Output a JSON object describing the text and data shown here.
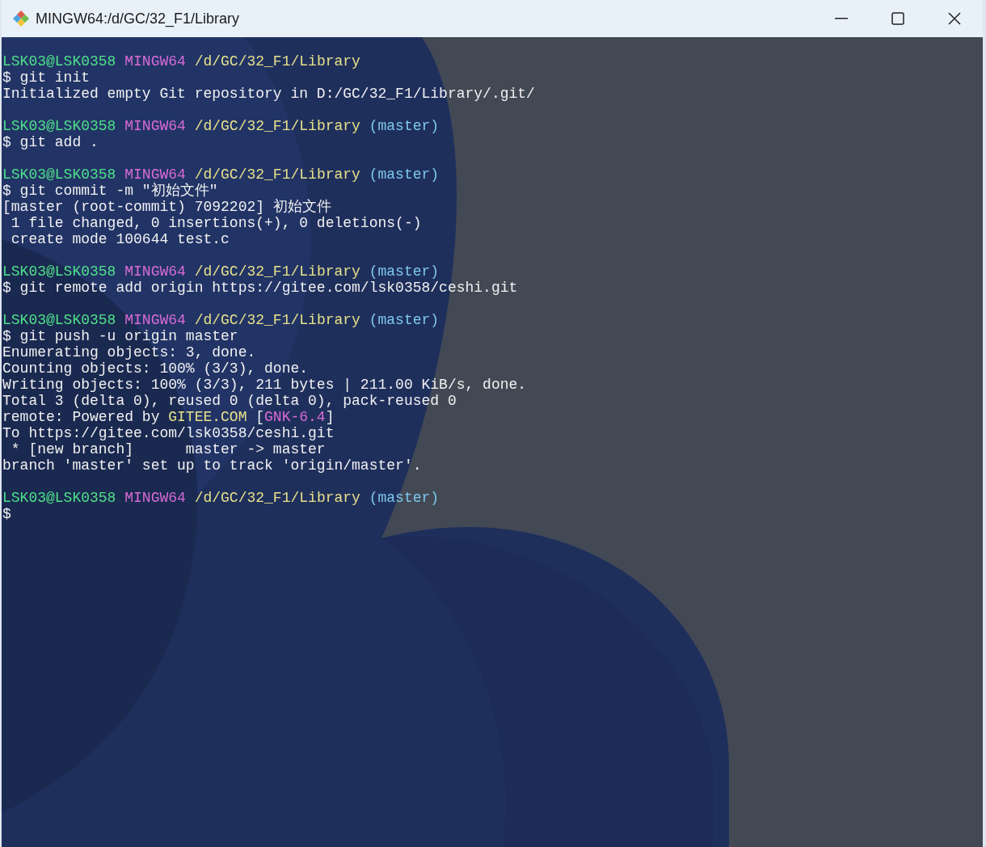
{
  "window": {
    "title": "MINGW64:/d/GC/32_F1/Library"
  },
  "terminal": {
    "blocks": [
      {
        "lines": [
          {
            "segments": [
              {
                "kind": "user",
                "text": "LSK03@LSK0358"
              },
              {
                "kind": "host",
                "text": "MINGW64"
              },
              {
                "kind": "path",
                "text": "/d/GC/32_F1/Library"
              }
            ]
          },
          {
            "segments": [
              {
                "kind": "plain",
                "text": "$ git init"
              }
            ]
          },
          {
            "segments": [
              {
                "kind": "plain",
                "text": "Initialized empty Git repository in D:/GC/32_F1/Library/.git/"
              }
            ]
          }
        ]
      },
      {
        "lines": [
          {
            "segments": [
              {
                "kind": "user",
                "text": "LSK03@LSK0358"
              },
              {
                "kind": "host",
                "text": "MINGW64"
              },
              {
                "kind": "path",
                "text": "/d/GC/32_F1/Library"
              },
              {
                "kind": "branch",
                "text": "(master)"
              }
            ]
          },
          {
            "segments": [
              {
                "kind": "plain",
                "text": "$ git add ."
              }
            ]
          }
        ]
      },
      {
        "lines": [
          {
            "segments": [
              {
                "kind": "user",
                "text": "LSK03@LSK0358"
              },
              {
                "kind": "host",
                "text": "MINGW64"
              },
              {
                "kind": "path",
                "text": "/d/GC/32_F1/Library"
              },
              {
                "kind": "branch",
                "text": "(master)"
              }
            ]
          },
          {
            "segments": [
              {
                "kind": "plain",
                "text": "$ git commit -m \"初始文件\""
              }
            ]
          },
          {
            "segments": [
              {
                "kind": "plain",
                "text": "[master (root-commit) 7092202] 初始文件"
              }
            ]
          },
          {
            "segments": [
              {
                "kind": "plain",
                "text": " 1 file changed, 0 insertions(+), 0 deletions(-)"
              }
            ]
          },
          {
            "segments": [
              {
                "kind": "plain",
                "text": " create mode 100644 test.c"
              }
            ]
          }
        ]
      },
      {
        "lines": [
          {
            "segments": [
              {
                "kind": "user",
                "text": "LSK03@LSK0358"
              },
              {
                "kind": "host",
                "text": "MINGW64"
              },
              {
                "kind": "path",
                "text": "/d/GC/32_F1/Library"
              },
              {
                "kind": "branch",
                "text": "(master)"
              }
            ]
          },
          {
            "segments": [
              {
                "kind": "plain",
                "text": "$ git remote add origin https://gitee.com/lsk0358/ceshi.git"
              }
            ]
          }
        ]
      },
      {
        "lines": [
          {
            "segments": [
              {
                "kind": "user",
                "text": "LSK03@LSK0358"
              },
              {
                "kind": "host",
                "text": "MINGW64"
              },
              {
                "kind": "path",
                "text": "/d/GC/32_F1/Library"
              },
              {
                "kind": "branch",
                "text": "(master)"
              }
            ]
          },
          {
            "segments": [
              {
                "kind": "plain",
                "text": "$ git push -u origin master"
              }
            ]
          },
          {
            "segments": [
              {
                "kind": "plain",
                "text": "Enumerating objects: 3, done."
              }
            ]
          },
          {
            "segments": [
              {
                "kind": "plain",
                "text": "Counting objects: 100% (3/3), done."
              }
            ]
          },
          {
            "segments": [
              {
                "kind": "plain",
                "text": "Writing objects: 100% (3/3), 211 bytes | 211.00 KiB/s, done."
              }
            ]
          },
          {
            "segments": [
              {
                "kind": "plain",
                "text": "Total 3 (delta 0), reused 0 (delta 0), pack-reused 0"
              }
            ]
          },
          {
            "segments": [
              {
                "kind": "plain",
                "text": "remote: Powered by"
              },
              {
                "kind": "path",
                "text": "GITEE.COM"
              },
              {
                "kind": "plain",
                "text": "["
              },
              {
                "kind": "host",
                "text": "GNK-6.4",
                "attached": true
              },
              {
                "kind": "plain",
                "text": "]",
                "attached": true
              }
            ]
          },
          {
            "segments": [
              {
                "kind": "plain",
                "text": "To https://gitee.com/lsk0358/ceshi.git"
              }
            ]
          },
          {
            "segments": [
              {
                "kind": "plain",
                "text": " * [new branch]      master -> master"
              }
            ]
          },
          {
            "segments": [
              {
                "kind": "plain",
                "text": "branch 'master' set up to track 'origin/master'."
              }
            ]
          }
        ]
      },
      {
        "lines": [
          {
            "segments": [
              {
                "kind": "user",
                "text": "LSK03@LSK0358"
              },
              {
                "kind": "host",
                "text": "MINGW64"
              },
              {
                "kind": "path",
                "text": "/d/GC/32_F1/Library"
              },
              {
                "kind": "branch",
                "text": "(master)"
              }
            ]
          },
          {
            "segments": [
              {
                "kind": "plain",
                "text": "$"
              }
            ]
          }
        ]
      }
    ]
  }
}
